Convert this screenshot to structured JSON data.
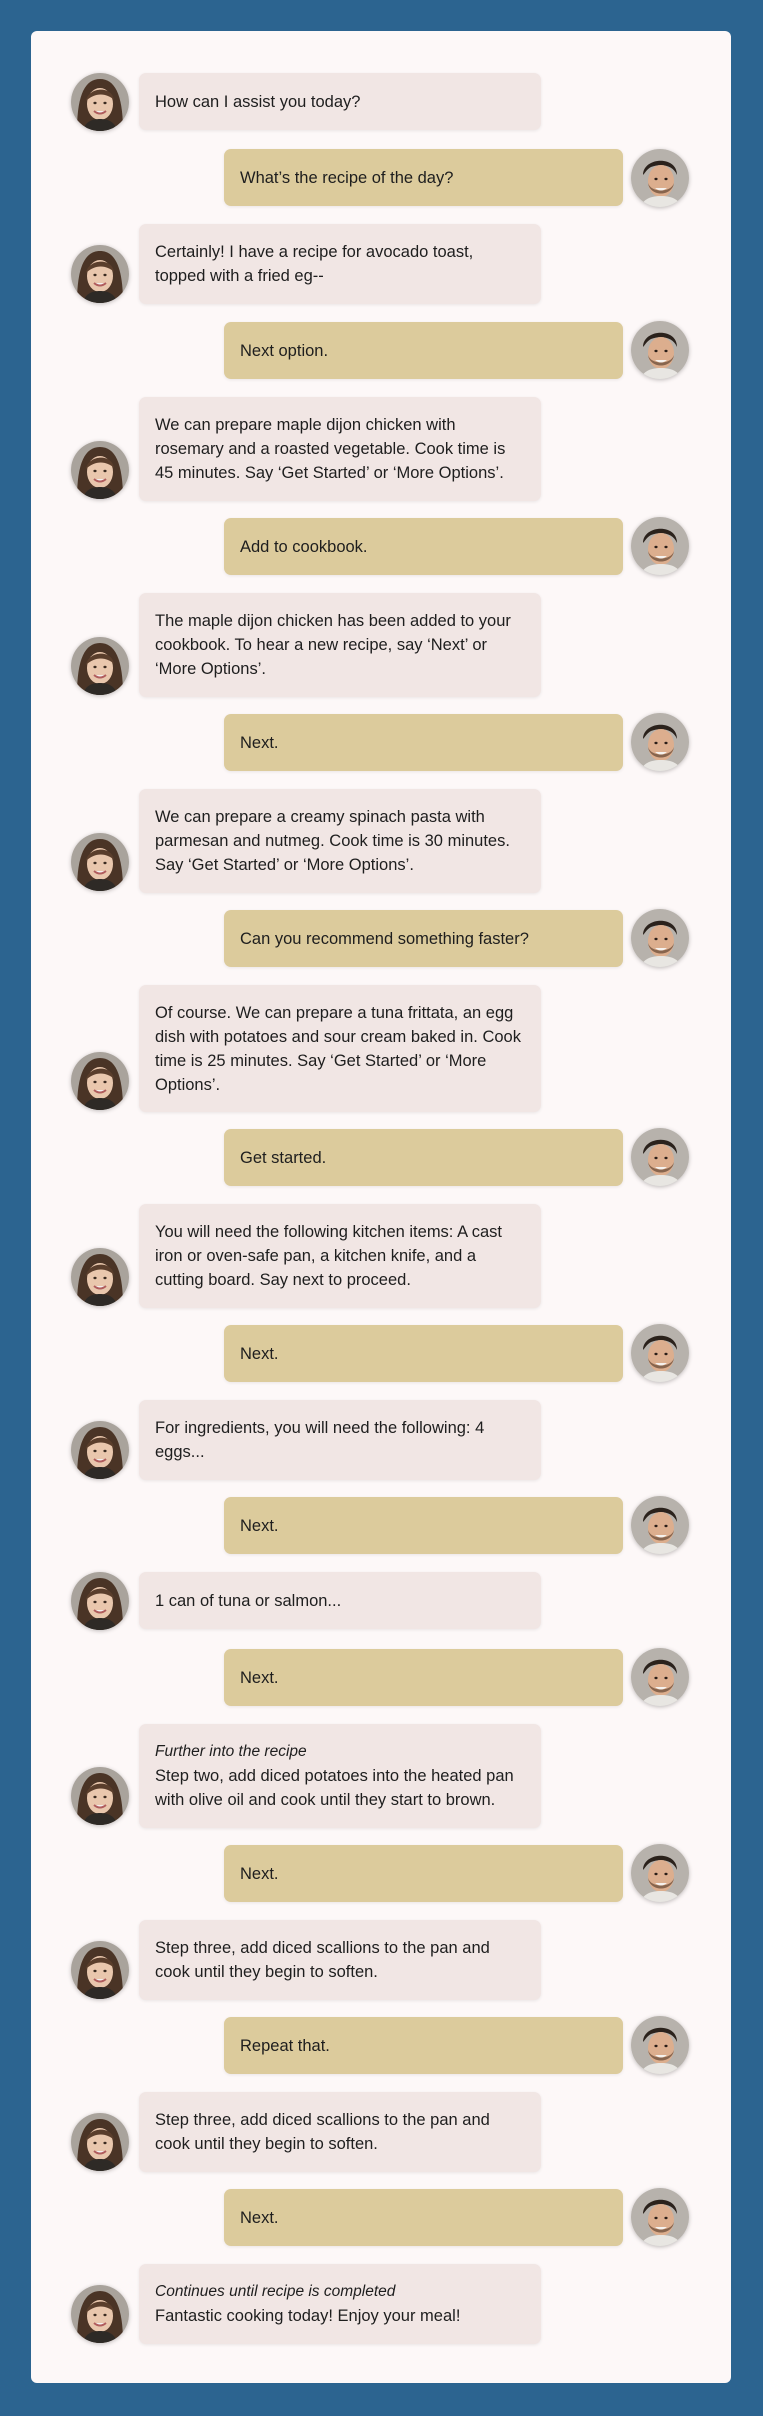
{
  "conversation": {
    "messages": [
      {
        "role": "assistant",
        "text": "How can I assist you today?"
      },
      {
        "role": "user",
        "text": "What’s the recipe of the day?"
      },
      {
        "role": "assistant",
        "text": "Certainly! I have a recipe for avocado toast, topped with a fried eg--"
      },
      {
        "role": "user",
        "text": "Next option."
      },
      {
        "role": "assistant",
        "text": "We can prepare maple dijon chicken with rosemary and a roasted vegetable. Cook time is 45 minutes. Say ‘Get Started’ or ‘More Options’."
      },
      {
        "role": "user",
        "text": "Add to cookbook."
      },
      {
        "role": "assistant",
        "text": "The maple dijon chicken has been added to your cookbook. To hear a new recipe, say ‘Next’ or ‘More Options’."
      },
      {
        "role": "user",
        "text": "Next."
      },
      {
        "role": "assistant",
        "text": "We can prepare a creamy spinach pasta with parmesan and nutmeg. Cook time is 30 minutes. Say ‘Get Started’ or ‘More Options’."
      },
      {
        "role": "user",
        "text": "Can you recommend something faster?"
      },
      {
        "role": "assistant",
        "text": "Of course. We can prepare a tuna frittata, an egg dish with potatoes and sour cream baked in. Cook time is 25 minutes. Say ‘Get Started’ or ‘More Options’."
      },
      {
        "role": "user",
        "text": "Get started."
      },
      {
        "role": "assistant",
        "text": "You will need the following kitchen items: A cast iron or oven-safe pan, a kitchen knife, and a cutting board. Say next to proceed."
      },
      {
        "role": "user",
        "text": "Next."
      },
      {
        "role": "assistant",
        "text": "For ingredients, you will need the following: 4 eggs..."
      },
      {
        "role": "user",
        "text": "Next."
      },
      {
        "role": "assistant",
        "text": "1 can of tuna or salmon..."
      },
      {
        "role": "user",
        "text": "Next."
      },
      {
        "role": "assistant",
        "note": "Further into the recipe",
        "text": "Step two, add diced potatoes into the heated pan with olive oil and cook until they start to brown."
      },
      {
        "role": "user",
        "text": "Next."
      },
      {
        "role": "assistant",
        "text": "Step three, add diced scallions to the pan and cook until they begin to soften."
      },
      {
        "role": "user",
        "text": "Repeat that."
      },
      {
        "role": "assistant",
        "text": "Step three, add diced scallions to the pan and cook until they begin to soften."
      },
      {
        "role": "user",
        "text": "Next."
      },
      {
        "role": "assistant",
        "note": "Continues until recipe is completed",
        "text": "Fantastic cooking today! Enjoy your meal!"
      }
    ]
  },
  "avatars": {
    "assistant": "woman-avatar-icon",
    "user": "man-avatar-icon"
  },
  "colors": {
    "background": "#2c6490",
    "panel": "#fdf8f8",
    "assistant_bubble": "#f1e6e4",
    "user_bubble": "#dccb9c"
  }
}
